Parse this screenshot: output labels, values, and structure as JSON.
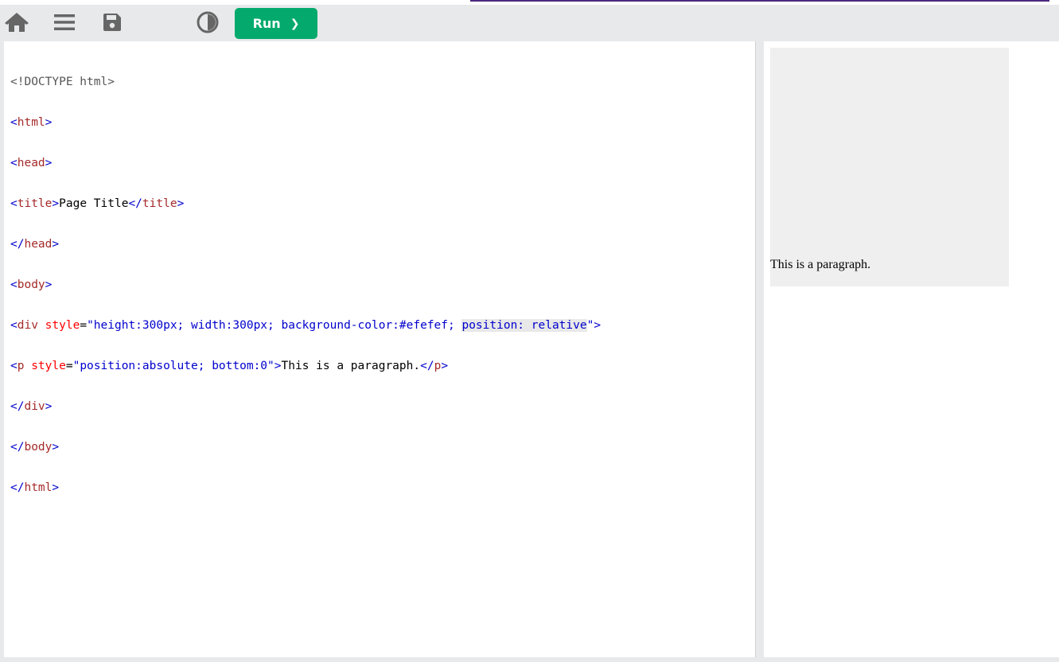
{
  "toolbar": {
    "icons": {
      "home": "home-icon",
      "menu": "menu-icon",
      "save": "save-icon",
      "theme": "contrast-icon"
    },
    "run_label": "Run",
    "run_arrow": "❯",
    "run_color": "#04aa6d",
    "accent_color": "#4b2a7b"
  },
  "editor": {
    "lines": {
      "l1": "<!DOCTYPE html>",
      "l2_tag": "html",
      "l3_tag": "head",
      "l4_tag": "title",
      "l4_text": "Page Title",
      "l5_tag": "head",
      "l6_tag": "body",
      "l7_tag": "div",
      "l7_attr": "style",
      "l7_val_a": "\"height:300px; width:300px; background-color:#efefef; ",
      "l7_val_b": "position: relative",
      "l7_val_c": "\"",
      "l8_tag": "p",
      "l8_attr": "style",
      "l8_val": "\"position:absolute; bottom:0\"",
      "l8_text": "This is a paragraph.",
      "l9_tag": "div",
      "l10_tag": "body",
      "l11_tag": "html"
    }
  },
  "preview": {
    "paragraph": "This is a paragraph.",
    "box_color": "#efefef"
  }
}
